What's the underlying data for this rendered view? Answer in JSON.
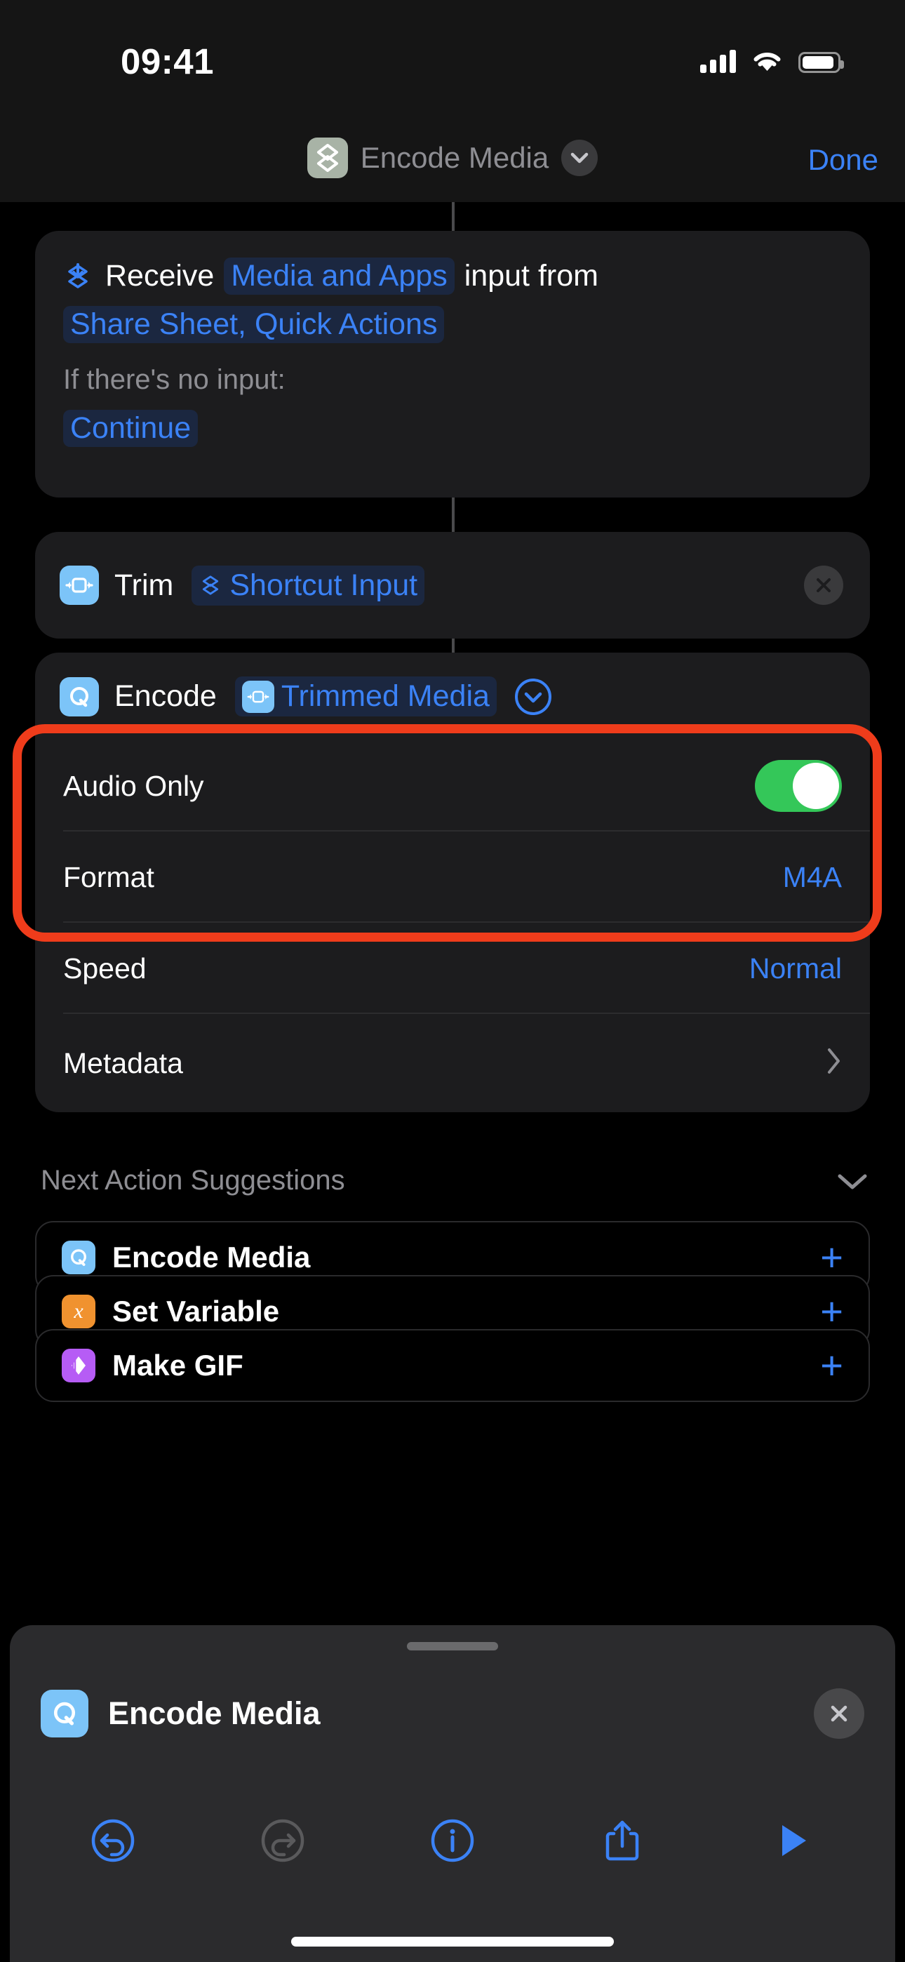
{
  "statusbar": {
    "time": "09:41",
    "cellular_icon": "cellular-signal-icon",
    "wifi_icon": "wifi-icon",
    "battery_icon": "battery-icon"
  },
  "navbar": {
    "app_icon": "shortcuts-app-icon",
    "title": "Encode Media",
    "chevron_icon": "chevron-down-icon",
    "done_label": "Done"
  },
  "receive_action": {
    "icon": "shortcut-input-icon",
    "verb": "Receive",
    "input_types_token": "Media and Apps",
    "middle_text": "input from",
    "sources_token": "Share Sheet, Quick Actions",
    "no_input_label": "If there's no input:",
    "no_input_token": "Continue"
  },
  "trim_action": {
    "icon": "trim-media-icon",
    "name": "Trim",
    "variable_icon": "shortcut-input-icon",
    "variable_token": "Shortcut Input",
    "close_icon": "close-icon"
  },
  "encode_action": {
    "icon": "encode-media-icon",
    "name": "Encode",
    "variable_icon": "trim-media-icon",
    "variable_token": "Trimmed Media",
    "expand_icon": "chevron-down-circle-icon",
    "close_icon": "close-icon",
    "parameters": [
      {
        "label": "Audio Only",
        "type": "toggle",
        "value": "on"
      },
      {
        "label": "Format",
        "type": "value",
        "value": "M4A"
      },
      {
        "label": "Speed",
        "type": "value",
        "value": "Normal"
      },
      {
        "label": "Metadata",
        "type": "disclosure",
        "value": ""
      }
    ]
  },
  "annotation": {
    "color": "#ef3c1b",
    "shape": "rounded-rectangle-highlight"
  },
  "next_action_suggestions": {
    "title": "Next Action Suggestions",
    "collapse_icon": "chevron-down-icon",
    "items": [
      {
        "name": "Encode Media",
        "icon": "encode-media-icon",
        "icon_color": "#7cc4f8",
        "add_icon": "plus-icon"
      },
      {
        "name": "Set Variable",
        "icon": "set-variable-icon",
        "icon_color": "#f0922f",
        "add_icon": "plus-icon"
      },
      {
        "name": "Make GIF",
        "icon": "make-gif-icon",
        "icon_color": "#b65cf5",
        "add_icon": "plus-icon"
      }
    ]
  },
  "bottom_sheet": {
    "grabber": "sheet-grabber",
    "icon": "encode-media-icon",
    "title": "Encode Media",
    "close_icon": "close-icon"
  },
  "toolbar": {
    "items": [
      {
        "name": "undo",
        "icon": "undo-icon",
        "enabled": "true"
      },
      {
        "name": "redo",
        "icon": "redo-icon",
        "enabled": "false"
      },
      {
        "name": "info",
        "icon": "info-circle-icon",
        "enabled": "true"
      },
      {
        "name": "share",
        "icon": "share-icon",
        "enabled": "true"
      },
      {
        "name": "run",
        "icon": "play-icon",
        "enabled": "true"
      }
    ]
  },
  "colors": {
    "accent_blue": "#3b82f6",
    "toggle_green": "#34c759",
    "annotation_red": "#ef3c1b"
  }
}
